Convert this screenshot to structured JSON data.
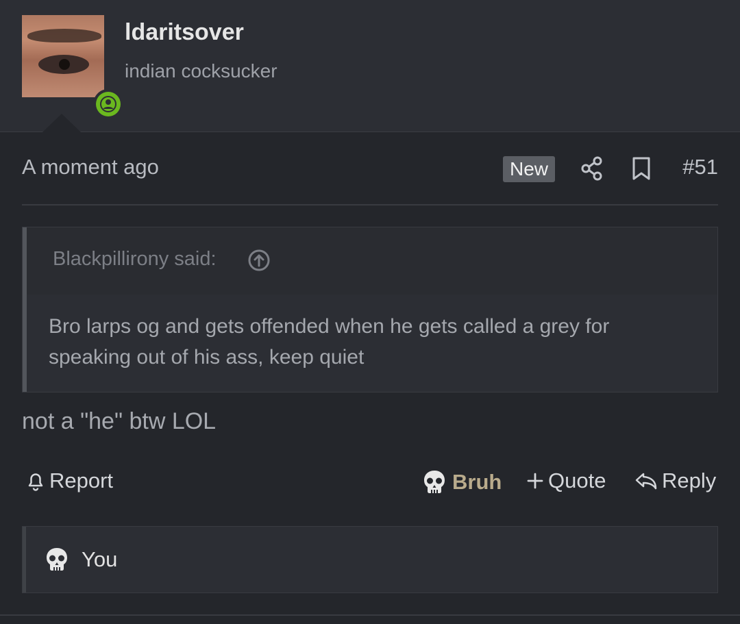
{
  "user": {
    "username": "ldaritsover",
    "title": "indian cocksucker",
    "status": "online"
  },
  "post": {
    "timestamp": "A moment ago",
    "new_badge": "New",
    "number": "#51",
    "quote": {
      "author": "Blackpillirony said:",
      "text": "Bro larps og and gets offended when he gets called a grey for speaking out of his ass, keep quiet"
    },
    "message": "not a \"he\" btw LOL"
  },
  "actions": {
    "report": "Report",
    "react": "Bruh",
    "quote": "Quote",
    "reply": "Reply"
  },
  "reactions": {
    "users": "You"
  },
  "colors": {
    "background": "#24262b",
    "panel": "#2c2e34",
    "online_green": "#6bb81f",
    "bruh_text": "#b9ab8c"
  },
  "icons": [
    "user-icon",
    "share-icon",
    "bookmark-icon",
    "arrow-up-circle-icon",
    "bell-icon",
    "skull-icon",
    "plus-icon",
    "reply-icon"
  ]
}
